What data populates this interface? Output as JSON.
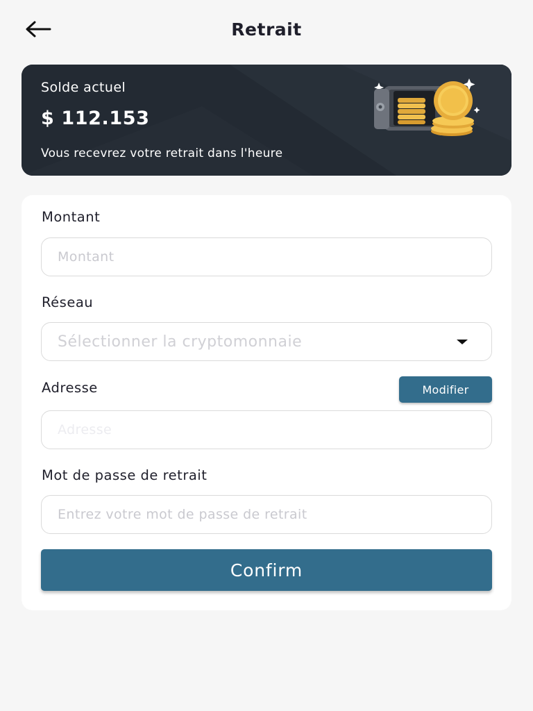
{
  "header": {
    "title": "Retrait",
    "back_icon": "arrow-left-icon"
  },
  "balance": {
    "label": "Solde actuel",
    "amount": "$ 112.153",
    "note": "Vous recevrez votre retrait dans l'heure",
    "illustration": "safe-with-coins-icon"
  },
  "form": {
    "amount": {
      "label": "Montant",
      "placeholder": "Montant",
      "value": ""
    },
    "network": {
      "label": "Réseau",
      "placeholder": "Sélectionner la cryptomonnaie",
      "icon": "chevron-down-icon"
    },
    "address": {
      "label": "Adresse",
      "placeholder": "Adresse",
      "value": "",
      "modify_label": "Modifier"
    },
    "password": {
      "label": "Mot de passe de retrait",
      "placeholder": "Entrez votre mot de passe de retrait",
      "value": ""
    },
    "confirm_label": "Confirm"
  },
  "colors": {
    "accent": "#336d8c",
    "card_dark": "#232a33",
    "background": "#f6f6f6"
  }
}
